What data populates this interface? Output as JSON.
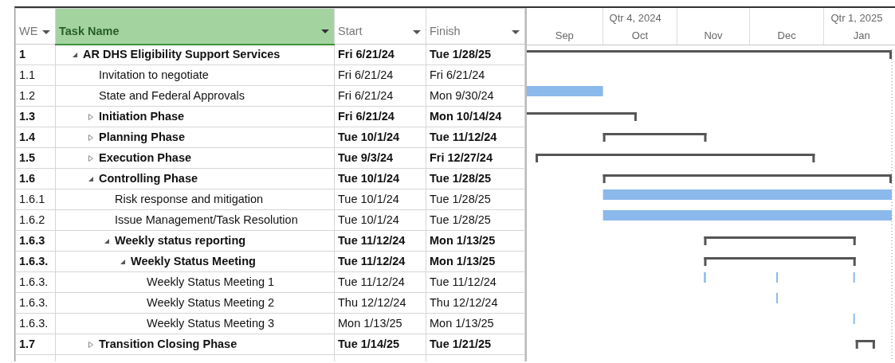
{
  "columns": [
    {
      "label": "WE",
      "selected": false
    },
    {
      "label": "Task Name",
      "selected": true
    },
    {
      "label": "Start",
      "selected": false
    },
    {
      "label": "Finish",
      "selected": false
    }
  ],
  "timescale": {
    "months": [
      {
        "label": "Sep"
      },
      {
        "label": "Oct",
        "quarter": "Qtr 4, 2024"
      },
      {
        "label": "Nov"
      },
      {
        "label": "Dec"
      },
      {
        "label": "Jan",
        "quarter": "Qtr 1, 2025"
      }
    ]
  },
  "tasks": [
    {
      "wbs": "1",
      "name": "AR DHS Eligibility Support Services",
      "start": "Fri 6/21/24",
      "finish": "Tue 1/28/25",
      "kind": "summary",
      "expanded": true,
      "children": [
        {
          "wbs": "1.1",
          "name": "Invitation to negotiate",
          "start": "Fri 6/21/24",
          "finish": "Fri 6/21/24",
          "kind": "task"
        },
        {
          "wbs": "1.2",
          "name": "State and Federal Approvals",
          "start": "Fri 6/21/24",
          "finish": "Mon 9/30/24",
          "kind": "task"
        },
        {
          "wbs": "1.3",
          "name": "Initiation Phase",
          "start": "Fri 6/21/24",
          "finish": "Mon 10/14/24",
          "kind": "summary",
          "expanded": false
        },
        {
          "wbs": "1.4",
          "name": "Planning Phase",
          "start": "Tue 10/1/24",
          "finish": "Tue 11/12/24",
          "kind": "summary",
          "expanded": false
        },
        {
          "wbs": "1.5",
          "name": "Execution Phase",
          "start": "Tue 9/3/24",
          "finish": "Fri 12/27/24",
          "kind": "summary",
          "expanded": false
        },
        {
          "wbs": "1.6",
          "name": "Controlling Phase",
          "start": "Tue 10/1/24",
          "finish": "Tue 1/28/25",
          "kind": "summary",
          "expanded": true,
          "children": [
            {
              "wbs": "1.6.1",
              "name": "Risk response and mitigation",
              "start": "Tue 10/1/24",
              "finish": "Tue 1/28/25",
              "kind": "task"
            },
            {
              "wbs": "1.6.2",
              "name": "Issue Management/Task Resolution",
              "start": "Tue 10/1/24",
              "finish": "Tue 1/28/25",
              "kind": "task"
            },
            {
              "wbs": "1.6.3",
              "name": "Weekly status reporting",
              "start": "Tue 11/12/24",
              "finish": "Mon 1/13/25",
              "kind": "summary",
              "expanded": true,
              "children": [
                {
                  "wbs": "1.6.3.",
                  "name": "Weekly Status Meeting",
                  "start": "Tue 11/12/24",
                  "finish": "Mon 1/13/25",
                  "kind": "summary",
                  "expanded": true,
                  "rollup": true,
                  "children": [
                    {
                      "wbs": "1.6.3.",
                      "name": "Weekly Status Meeting 1",
                      "start": "Tue 11/12/24",
                      "finish": "Tue 11/12/24",
                      "kind": "task"
                    },
                    {
                      "wbs": "1.6.3.",
                      "name": "Weekly Status Meeting 2",
                      "start": "Thu 12/12/24",
                      "finish": "Thu 12/12/24",
                      "kind": "task"
                    },
                    {
                      "wbs": "1.6.3.",
                      "name": "Weekly Status Meeting 3",
                      "start": "Mon 1/13/25",
                      "finish": "Mon 1/13/25",
                      "kind": "task"
                    }
                  ]
                }
              ]
            }
          ]
        },
        {
          "wbs": "1.7",
          "name": "Transition Closing Phase",
          "start": "Tue 1/14/25",
          "finish": "Tue 1/21/25",
          "kind": "summary",
          "expanded": false
        }
      ]
    }
  ]
}
